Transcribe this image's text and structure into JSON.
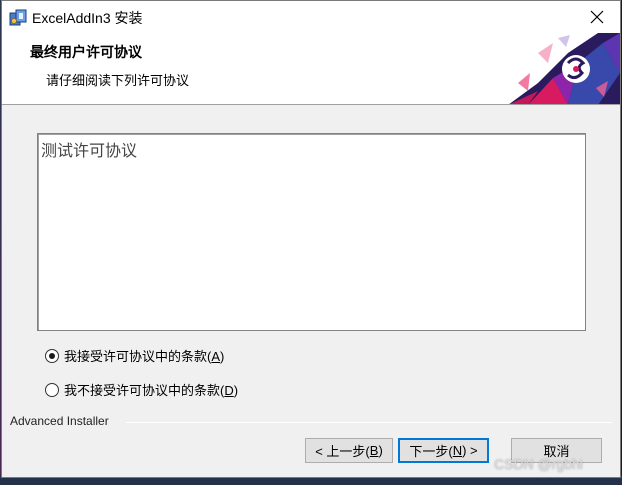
{
  "window": {
    "title": "ExcelAddIn3 安装",
    "close_glyph": "✕"
  },
  "header": {
    "title": "最终用户许可协议",
    "subtitle": "请仔细阅读下列许可协议"
  },
  "license": {
    "text": "测试许可协议"
  },
  "options": [
    {
      "label_prefix": "我接受许可协议中的条款(",
      "accel": "A",
      "label_suffix": ")",
      "checked": true
    },
    {
      "label_prefix": "我不接受许可协议中的条款(",
      "accel": "D",
      "label_suffix": ")",
      "checked": false
    }
  ],
  "footer": {
    "brand": "Advanced Installer"
  },
  "buttons": {
    "back": {
      "prefix": "< 上一步(",
      "accel": "B",
      "suffix": ")"
    },
    "next": {
      "prefix": "下一步(",
      "accel": "N",
      "suffix": ") >"
    },
    "cancel": {
      "label": "取消"
    }
  },
  "watermark": "CSDN @rgbhi",
  "colors": {
    "accent": "#0078d7",
    "banner_dark": "#2a1a5e",
    "banner_magenta": "#d81b60"
  },
  "icons": [
    "installer-app-icon",
    "close-icon",
    "banner-logo-icon",
    "radio-checked-icon",
    "radio-unchecked-icon"
  ]
}
